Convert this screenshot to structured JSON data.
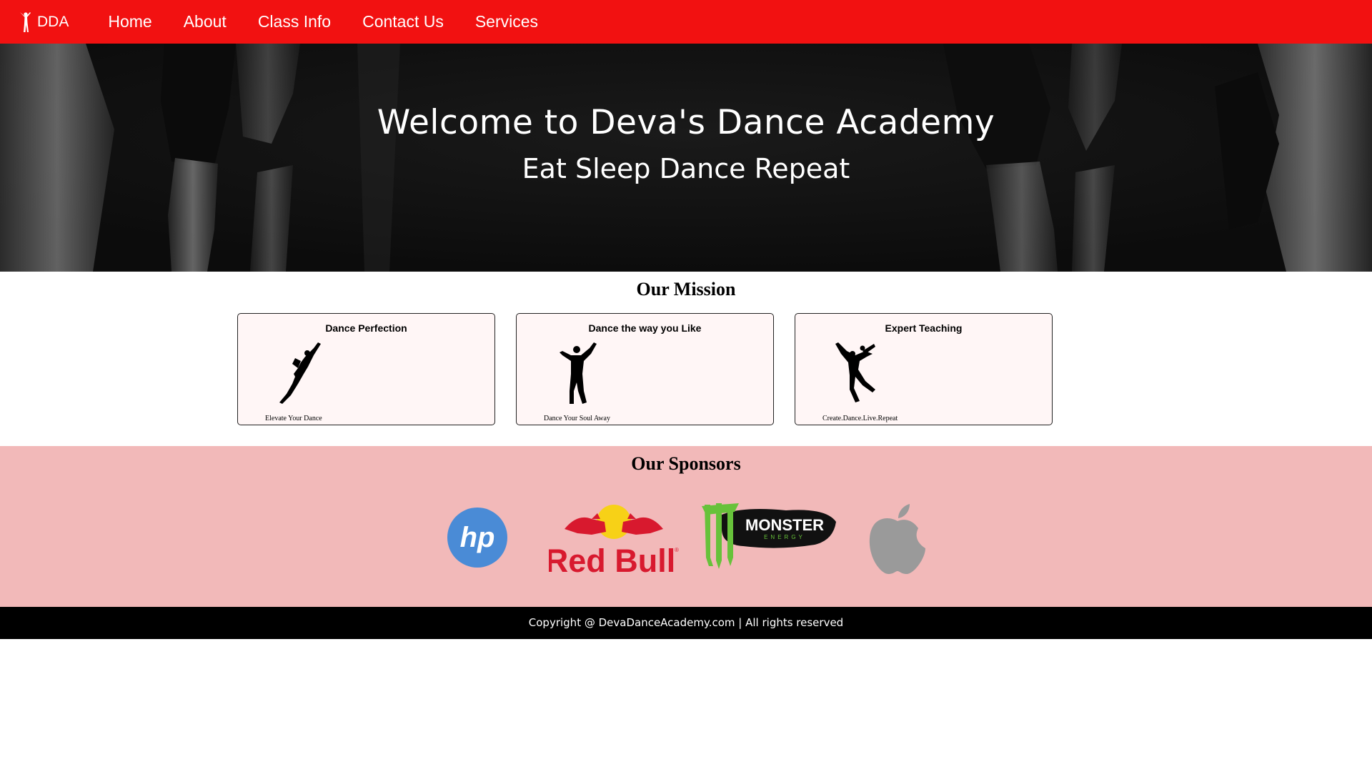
{
  "navbar": {
    "brand": "DDA",
    "links": [
      "Home",
      "About",
      "Class Info",
      "Contact Us",
      "Services"
    ]
  },
  "hero": {
    "title": "Welcome to Deva's Dance Academy",
    "subtitle": "Eat Sleep Dance Repeat"
  },
  "mission": {
    "heading": "Our Mission",
    "cards": [
      {
        "title": "Dance Perfection",
        "caption": "Elevate Your Dance",
        "icon": "leaping-dancer-icon"
      },
      {
        "title": "Dance the way you Like",
        "caption": "Dance Your Soul Away",
        "icon": "male-dancer-icon"
      },
      {
        "title": "Expert Teaching",
        "caption": "Create.Dance.Live.Repeat",
        "icon": "couple-dancer-icon"
      }
    ]
  },
  "sponsors": {
    "heading": "Our Sponsors",
    "logos": [
      {
        "name": "hp",
        "text": "hp"
      },
      {
        "name": "Red Bull",
        "text": "Red Bull"
      },
      {
        "name": "Monster Energy",
        "text": "MONSTER",
        "subtext": "ENERGY"
      },
      {
        "name": "Apple",
        "icon": "apple-icon"
      }
    ]
  },
  "footer": {
    "text": "Copyright @ DevaDanceAcademy.com | All rights reserved"
  },
  "colors": {
    "navbar": "#f21111",
    "sponsors_bg": "#f2b9b9",
    "card_bg": "#fff6f6",
    "footer_bg": "#000000"
  }
}
